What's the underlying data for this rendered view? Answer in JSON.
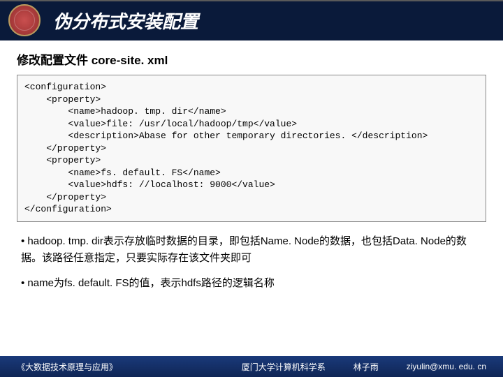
{
  "header": {
    "title": "伪分布式安装配置"
  },
  "subtitle": "修改配置文件 core-site. xml",
  "code": "<configuration>\n    <property>\n        <name>hadoop. tmp. dir</name>\n        <value>file: /usr/local/hadoop/tmp</value>\n        <description>Abase for other temporary directories. </description>\n    </property>\n    <property>\n        <name>fs. default. FS</name>\n        <value>hdfs: //localhost: 9000</value>\n    </property>\n</configuration>",
  "bullets": [
    " • hadoop. tmp. dir表示存放临时数据的目录，即包括Name. Node的数据，也包括Data. Node的数据。该路径任意指定，只要实际存在该文件夹即可",
    " • name为fs. default. FS的值，表示hdfs路径的逻辑名称"
  ],
  "footer": {
    "book": "《大数据技术原理与应用》",
    "dept": "厦门大学计算机科学系",
    "author": "林子雨",
    "email": "ziyulin@xmu. edu. cn"
  }
}
